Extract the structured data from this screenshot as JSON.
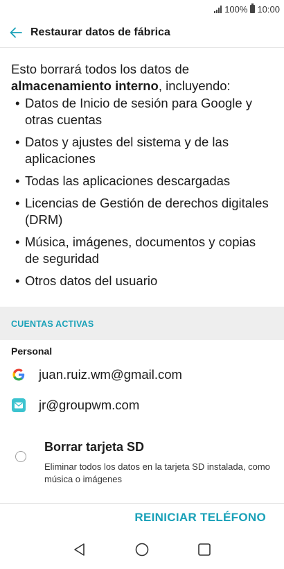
{
  "status_bar": {
    "battery": "100%",
    "time": "10:00"
  },
  "app_bar": {
    "title": "Restaurar datos de fábrica",
    "back_icon": "arrow-left-icon"
  },
  "intro": {
    "text_before": "Esto borrará todos los datos de ",
    "text_bold": "almacenamiento interno",
    "text_after": ", incluyendo:"
  },
  "bullets": [
    "Datos de Inicio de sesión para Google y otras cuentas",
    "Datos y ajustes del sistema y de las aplicaciones",
    "Todas las aplicaciones descargadas",
    "Licencias de Gestión de derechos digitales (DRM)",
    "Música, imágenes, documentos y copias de seguridad",
    "Otros datos del usuario"
  ],
  "bullet_symbol": "•",
  "accounts_section": {
    "header": "CUENTAS ACTIVAS",
    "group_label": "Personal",
    "accounts": [
      {
        "icon": "google-icon",
        "email": "juan.ruiz.wm@gmail.com"
      },
      {
        "icon": "mail-icon",
        "email": "jr@groupwm.com"
      }
    ]
  },
  "sd_option": {
    "title": "Borrar tarjeta SD",
    "description": "Eliminar todos los datos en la tarjeta SD instalada, como música o imágenes",
    "checked": false
  },
  "actions": {
    "reset_label": "REINICIAR TELÉFONO"
  },
  "nav_bar": {
    "back_icon": "nav-back-icon",
    "home_icon": "nav-home-icon",
    "recents_icon": "nav-recents-icon"
  },
  "colors": {
    "accent": "#1aa1b8",
    "section_bg": "#eeeeee",
    "text": "#1c1c1c"
  }
}
